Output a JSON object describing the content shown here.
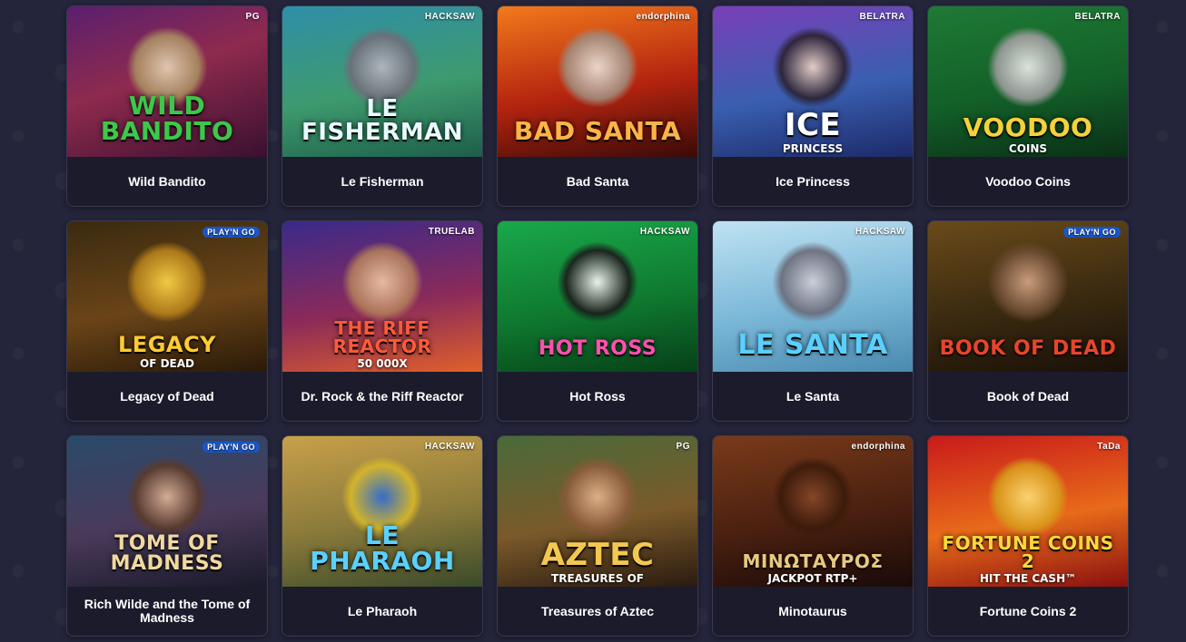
{
  "games": [
    {
      "name": "Wild Bandito",
      "art_title": "WILD BANDITO",
      "art_sub": "",
      "provider": "PG",
      "bg": "linear-gradient(160deg,#5a1f6e 0%,#8e2a4e 45%,#3a1030 100%)",
      "figure": "radial-gradient(circle,#e8d6b8 0%,#a88a60 55%,transparent 70%)",
      "title_color": "#3cc84a",
      "title_size": "28px"
    },
    {
      "name": "Le Fisherman",
      "art_title": "LE FISHERMAN",
      "art_sub": "",
      "provider": "HACKSAW",
      "bg": "linear-gradient(170deg,#2e8fa8 0%,#3e9a6e 55%,#1e5e4a 100%)",
      "figure": "radial-gradient(circle,#b9b9c2 0%,#6d6d78 55%,transparent 70%)",
      "title_color": "#e9fbff",
      "title_size": "26px"
    },
    {
      "name": "Bad Santa",
      "art_title": "BAD SANTA",
      "art_sub": "",
      "provider": "endorphina",
      "bg": "linear-gradient(170deg,#f17a1c 0%,#b5240f 55%,#3a0a08 100%)",
      "figure": "radial-gradient(circle,#f0e6dc 0%,#a08a7a 55%,transparent 70%)",
      "title_color": "#ffb347",
      "title_size": "28px"
    },
    {
      "name": "Ice Princess",
      "art_title": "ICE",
      "art_sub": "PRINCESS",
      "provider": "BELATRA",
      "bg": "linear-gradient(170deg,#7a3fb8 0%,#3a5fb0 55%,#1c2a6a 100%)",
      "figure": "radial-gradient(circle,#f4d9c8 0%,#2a2030 55%,transparent 70%)",
      "title_color": "#ffffff",
      "title_size": "34px"
    },
    {
      "name": "Voodoo Coins",
      "art_title": "VOODOO",
      "art_sub": "COINS",
      "provider": "BELATRA",
      "bg": "linear-gradient(170deg,#1e7a34 0%,#136029 55%,#0a3016 100%)",
      "figure": "radial-gradient(circle,#f0f0f0 0%,#9a9a9a 55%,transparent 70%)",
      "title_color": "#f4d23a",
      "title_size": "28px"
    },
    {
      "name": "Legacy of Dead",
      "art_title": "LEGACY",
      "art_sub": "OF DEAD",
      "provider": "PLAY'N GO",
      "bg": "linear-gradient(170deg,#3a2a10 0%,#6a4418 55%,#2a1a08 100%)",
      "figure": "radial-gradient(circle,#ffd94a 0%,#b5801a 55%,transparent 70%)",
      "title_color": "#ffcc33",
      "title_size": "24px"
    },
    {
      "name": "Dr. Rock & the Riff Reactor",
      "art_title": "THE RIFF REACTOR",
      "art_sub": "50 000X",
      "provider": "TRUELAB",
      "bg": "linear-gradient(170deg,#3a2a8a 0%,#8a2a5a 55%,#e0602a 100%)",
      "figure": "radial-gradient(circle,#f2c9a8 0%,#b07a5a 55%,transparent 70%)",
      "title_color": "#ff5a3a",
      "title_size": "20px"
    },
    {
      "name": "Hot Ross",
      "art_title": "HOT ROSS",
      "art_sub": "",
      "provider": "HACKSAW",
      "bg": "linear-gradient(170deg,#1aa84a 0%,#0f7a30 55%,#064018 100%)",
      "figure": "radial-gradient(circle,#ffffff 0%,#1a1a1a 55%,transparent 70%)",
      "title_color": "#ff4fb0",
      "title_size": "22px"
    },
    {
      "name": "Le Santa",
      "art_title": "LE SANTA",
      "art_sub": "",
      "provider": "HACKSAW",
      "bg": "linear-gradient(170deg,#bfe2f2 0%,#7bb8d8 55%,#4a8ab0 100%)",
      "figure": "radial-gradient(circle,#d0d0d8 0%,#6a6a78 55%,transparent 70%)",
      "title_color": "#5ad0ff",
      "title_size": "30px"
    },
    {
      "name": "Book of Dead",
      "art_title": "BOOK OF DEAD",
      "art_sub": "",
      "provider": "PLAY'N GO",
      "bg": "linear-gradient(170deg,#6a4a1a 0%,#3a2a10 55%,#1a1008 100%)",
      "figure": "radial-gradient(circle,#d8a888 0%,#6a4a30 55%,transparent 70%)",
      "title_color": "#e8452a",
      "title_size": "22px"
    },
    {
      "name": "Rich Wilde and the Tome of Madness",
      "art_title": "TOME OF MADNESS",
      "art_sub": "",
      "provider": "PLAY'N GO",
      "bg": "linear-gradient(170deg,#2a4a6a 0%,#4a3a5a 55%,#1a1a2a 100%)",
      "figure": "radial-gradient(circle,#e2b89a 0%,#5a3a2a 55%,transparent 70%)",
      "title_color": "#f0d8a0",
      "title_size": "22px"
    },
    {
      "name": "Le Pharaoh",
      "art_title": "LE PHARAOH",
      "art_sub": "",
      "provider": "HACKSAW",
      "bg": "linear-gradient(170deg,#c8a04a 0%,#8a7a3a 55%,#3a4a2a 100%)",
      "figure": "radial-gradient(circle,#2a6ad8 0%,#d8b82a 55%,transparent 70%)",
      "title_color": "#5ad0ff",
      "title_size": "28px"
    },
    {
      "name": "Treasures of Aztec",
      "art_title": "AZTEC",
      "art_sub": "TREASURES OF",
      "provider": "PG",
      "bg": "linear-gradient(170deg,#4a6a3a 0%,#7a5a2a 55%,#2a1a10 100%)",
      "figure": "radial-gradient(circle,#e8b890 0%,#8a5a3a 55%,transparent 70%)",
      "title_color": "#f4c850",
      "title_size": "34px"
    },
    {
      "name": "Minotaurus",
      "art_title": "ΜΙΝΩΤΑΥΡΟΣ",
      "art_sub": "JACKPOT RTP+",
      "provider": "endorphina",
      "bg": "linear-gradient(170deg,#7a3a1a 0%,#4a2010 55%,#1a0a08 100%)",
      "figure": "radial-gradient(circle,#8a4a2a 0%,#3a1a0a 55%,transparent 70%)",
      "title_color": "#e8c880",
      "title_size": "20px"
    },
    {
      "name": "Fortune Coins 2",
      "art_title": "FORTUNE COINS 2",
      "art_sub": "HIT THE CASH™",
      "provider": "TaDa",
      "bg": "linear-gradient(170deg,#c81a1a 0%,#e86a1a 55%,#8a1010 100%)",
      "figure": "radial-gradient(circle,#ffe07a 0%,#d89a1a 55%,transparent 70%)",
      "title_color": "#ffd83a",
      "title_size": "20px"
    }
  ]
}
